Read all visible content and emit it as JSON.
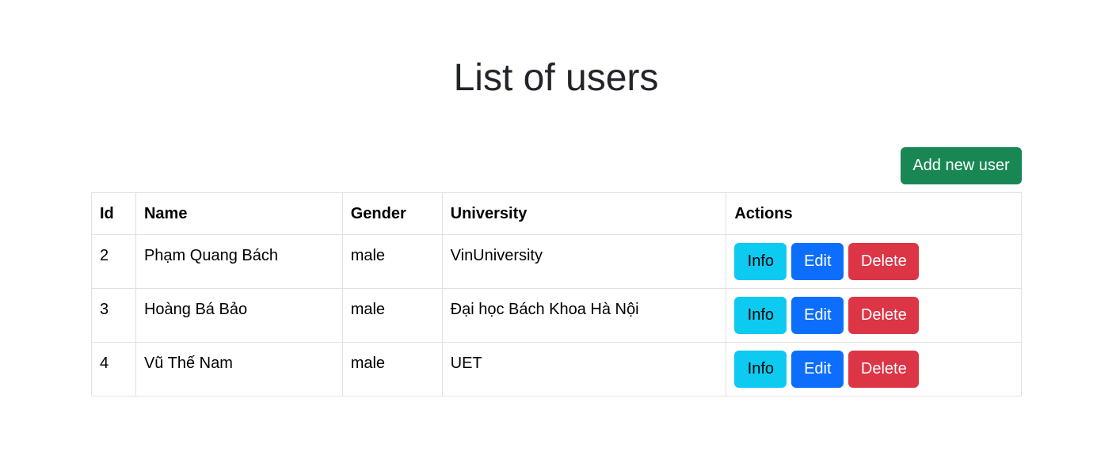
{
  "page": {
    "title": "List of users"
  },
  "toolbar": {
    "add_label": "Add new user"
  },
  "table": {
    "headers": {
      "id": "Id",
      "name": "Name",
      "gender": "Gender",
      "university": "University",
      "actions": "Actions"
    },
    "rows": [
      {
        "id": "2",
        "name": "Phạm Quang Bách",
        "gender": "male",
        "university": "VinUniversity"
      },
      {
        "id": "3",
        "name": "Hoàng Bá Bảo",
        "gender": "male",
        "university": "Đại học Bách Khoa Hà Nội"
      },
      {
        "id": "4",
        "name": "Vũ Thế Nam",
        "gender": "male",
        "university": "UET"
      }
    ],
    "action_labels": {
      "info": "Info",
      "edit": "Edit",
      "delete": "Delete"
    }
  },
  "colors": {
    "success": "#198754",
    "info": "#0dcaf0",
    "primary": "#0d6efd",
    "danger": "#dc3545"
  }
}
